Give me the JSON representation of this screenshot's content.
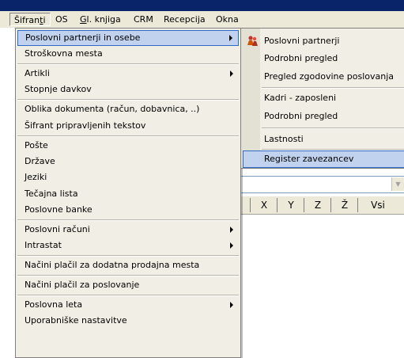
{
  "menubar": {
    "items": [
      {
        "pre": "Šifran",
        "u": "t",
        "post": "i"
      },
      {
        "pre": "",
        "u": "",
        "post": "OS"
      },
      {
        "pre": "",
        "u": "G",
        "post": "l. knjiga"
      },
      {
        "pre": "",
        "u": "",
        "post": "CRM"
      },
      {
        "pre": "",
        "u": "",
        "post": "Recepcija"
      },
      {
        "pre": "",
        "u": "",
        "post": "Okna"
      }
    ]
  },
  "menu": {
    "items": [
      {
        "label": "Poslovni partnerji in osebe",
        "submenu": true
      },
      {
        "label": "Stroškovna mesta",
        "submenu": false
      },
      {
        "label": "Artikli",
        "submenu": true
      },
      {
        "label": "Stopnje davkov",
        "submenu": false
      },
      {
        "label": "Oblika dokumenta (račun, dobavnica, ..)",
        "submenu": false
      },
      {
        "label": "Šifrant pripravljenih tekstov",
        "submenu": false
      },
      {
        "label": "Pošte",
        "submenu": false
      },
      {
        "label": "Države",
        "submenu": false
      },
      {
        "label": "Jeziki",
        "submenu": false
      },
      {
        "label": "Tečajna lista",
        "submenu": false
      },
      {
        "label": "Poslovne banke",
        "submenu": false
      },
      {
        "label": "Poslovni računi",
        "submenu": true
      },
      {
        "label": "Intrastat",
        "submenu": true
      },
      {
        "label": "Načini plačil za dodatna prodajna mesta",
        "submenu": false
      },
      {
        "label": "Načini plačil za poslovanje",
        "submenu": false
      },
      {
        "label": "Poslovna leta",
        "submenu": true
      },
      {
        "label": "Uporabniške nastavitve",
        "submenu": false
      }
    ]
  },
  "submenu": {
    "items": [
      {
        "label": "Poslovni partnerji"
      },
      {
        "label": "Podrobni pregled"
      },
      {
        "label": "Pregled zgodovine poslovanja"
      },
      {
        "label": "Kadri - zaposleni"
      },
      {
        "label": "Podrobni pregled"
      },
      {
        "label": "Lastnosti"
      },
      {
        "label": "Register zavezancev"
      }
    ]
  },
  "letterbar": {
    "letters": [
      "X",
      "Y",
      "Z",
      "Ž",
      "Vsi"
    ]
  },
  "colors": {
    "highlight_bg": "#c1d2ee",
    "highlight_border": "#316ac5",
    "menu_bg": "#f1efe5"
  }
}
